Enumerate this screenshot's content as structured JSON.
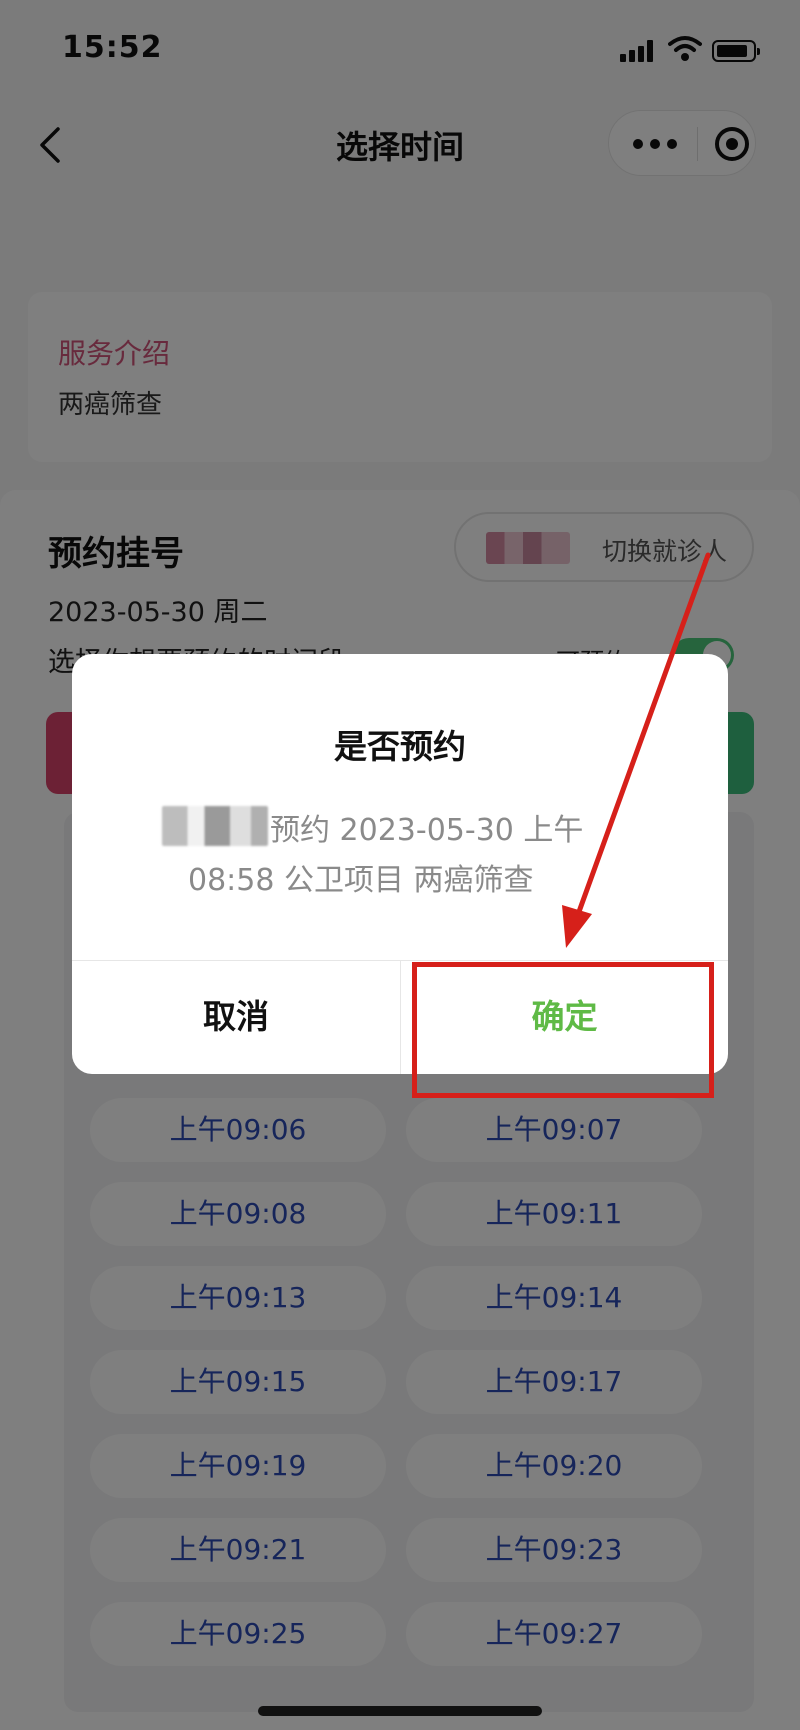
{
  "status_bar": {
    "time": "15:52"
  },
  "nav": {
    "title": "选择时间"
  },
  "service": {
    "title": "服务介绍",
    "description": "两癌筛查"
  },
  "booking": {
    "title": "预约挂号",
    "switch_patient_label": "切换就诊人",
    "date": "2023-05-30 周二",
    "hint": "选择你想要预约的时间段",
    "bookable_label": "可预约"
  },
  "slots": [
    "上午09:06",
    "上午09:07",
    "上午09:08",
    "上午09:11",
    "上午09:13",
    "上午09:14",
    "上午09:15",
    "上午09:17",
    "上午09:19",
    "上午09:20",
    "上午09:21",
    "上午09:23",
    "上午09:25",
    "上午09:27"
  ],
  "dialog": {
    "title": "是否预约",
    "message_line1": "预约 2023-05-30 上午",
    "message_line2": "08:58 公卫项目 两癌筛查",
    "cancel_label": "取消",
    "confirm_label": "确定"
  },
  "colors": {
    "confirm_green": "#5fba46",
    "slot_text_blue": "#2d4bb4",
    "service_title_pink": "#d1547a",
    "annotation_red": "#d6201a"
  }
}
